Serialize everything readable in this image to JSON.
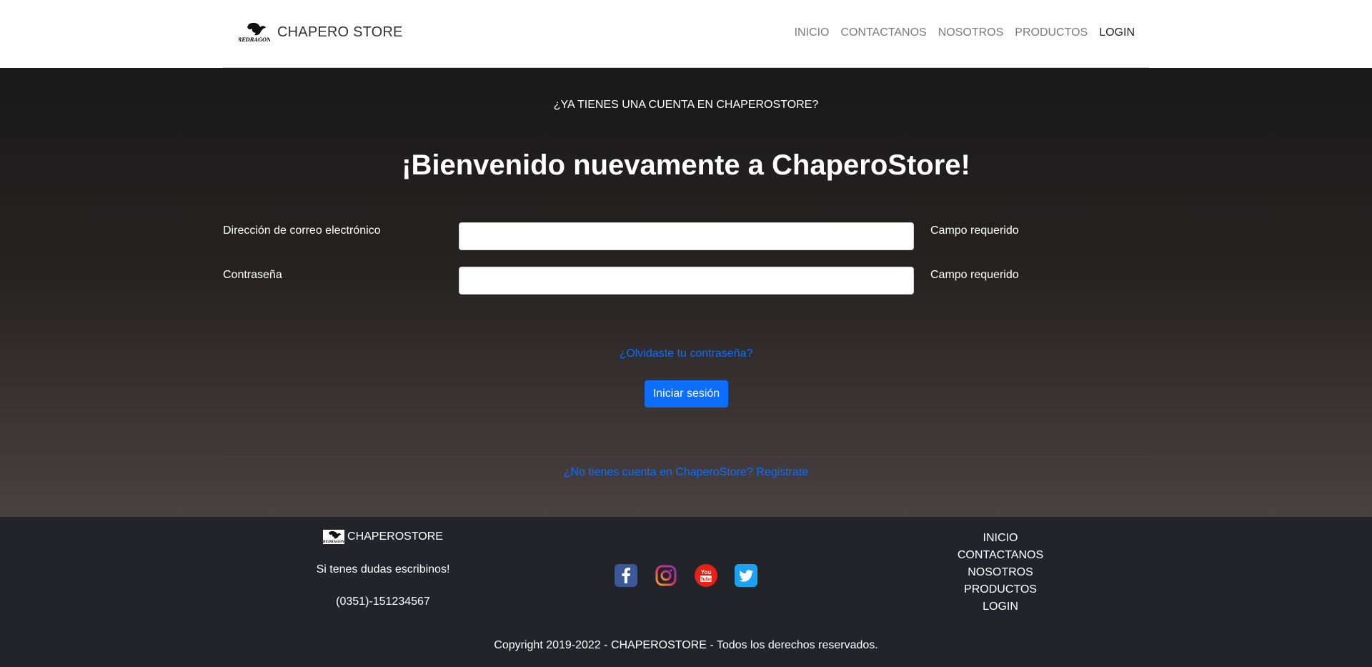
{
  "header": {
    "brand": "CHAPERO STORE",
    "nav": [
      "INICIO",
      "CONTACTANOS",
      "NOSOTROS",
      "PRODUCTOS",
      "LOGIN"
    ],
    "active_nav": "LOGIN"
  },
  "main": {
    "question": "¿YA TIENES UNA CUENTA EN CHAPEROSTORE?",
    "welcome": "¡Bienvenido nuevamente a ChaperoStore!",
    "email_label": "Dirección de correo electrónico",
    "email_value": "",
    "email_hint": "Campo requerido",
    "password_label": "Contraseña",
    "password_value": "",
    "password_hint": "Campo requerido",
    "forgot_link": "¿Olvidaste tu contraseña?",
    "login_button": "Iniciar sesión",
    "register_link": "¿No tienes cuenta en ChaperoStore? Registrate"
  },
  "footer": {
    "brand": "CHAPEROSTORE",
    "contact_text": "Si tenes dudas escribinos!",
    "phone": "(0351)-151234567",
    "socials": [
      "facebook-icon",
      "instagram-icon",
      "youtube-icon",
      "twitter-icon"
    ],
    "links": [
      "INICIO",
      "CONTACTANOS",
      "NOSOTROS",
      "PRODUCTOS",
      "LOGIN"
    ],
    "copyright": "Copyright 2019-2022 - CHAPEROSTORE - Todos los derechos reservados."
  },
  "colors": {
    "accent": "#0d6efd",
    "footer_bg": "#212529",
    "facebook": "#3b5998",
    "youtube": "#e62117",
    "twitter": "#1da1f2"
  }
}
